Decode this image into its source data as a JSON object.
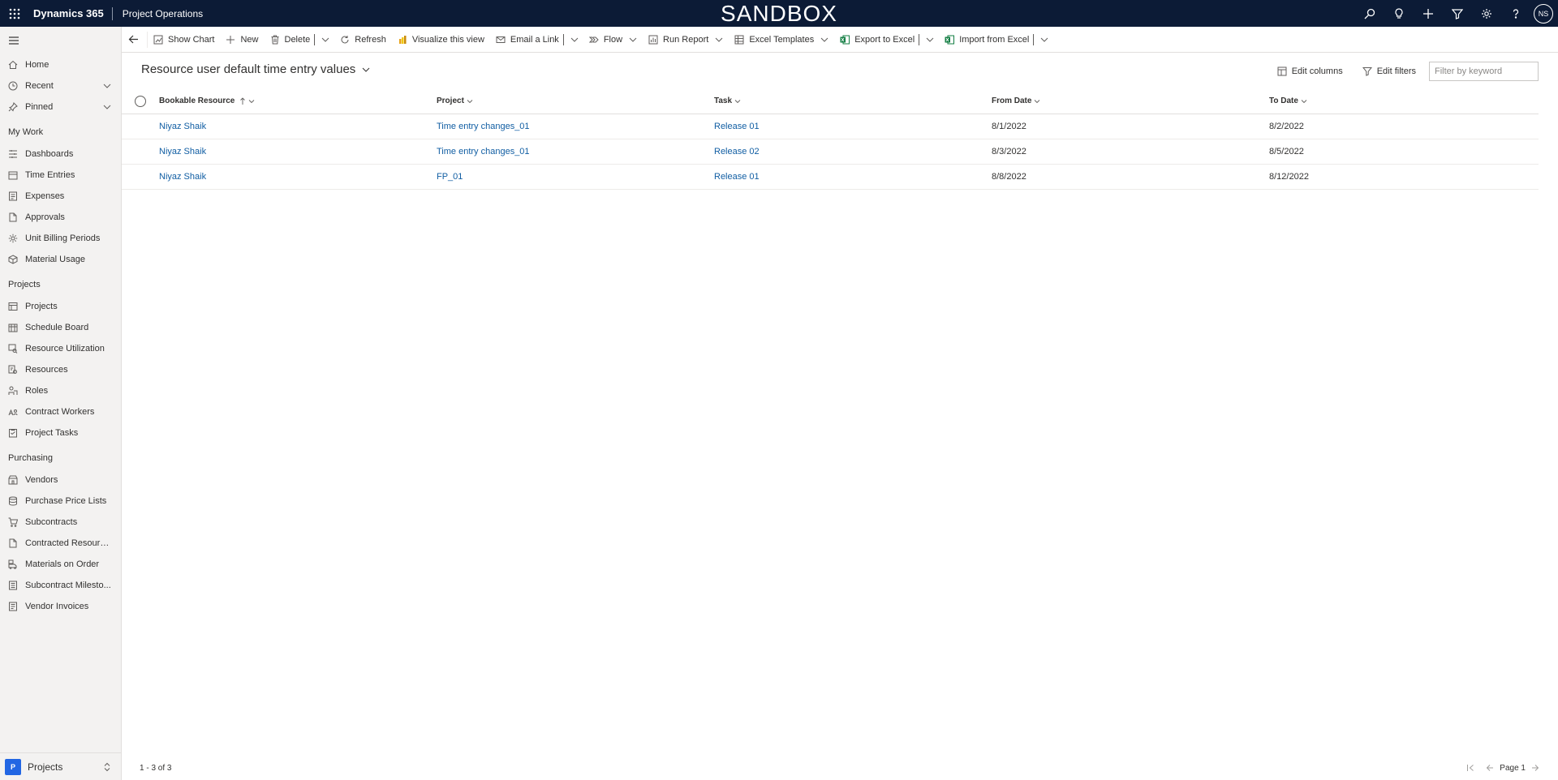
{
  "topbar": {
    "brand": "Dynamics 365",
    "app": "Project Operations",
    "environment": "SANDBOX",
    "avatar": "NS",
    "icons": [
      "search-icon",
      "lightbulb-icon",
      "plus-icon",
      "filter-icon",
      "gear-icon",
      "help-icon"
    ]
  },
  "sidebar": {
    "top": [
      {
        "label": "Home",
        "icon": "home-icon"
      },
      {
        "label": "Recent",
        "icon": "clock-icon"
      },
      {
        "label": "Pinned",
        "icon": "pin-icon"
      }
    ],
    "sections": [
      {
        "title": "My Work",
        "items": [
          {
            "label": "Dashboards",
            "icon": "dashboard-icon"
          },
          {
            "label": "Time Entries",
            "icon": "calendar-icon"
          },
          {
            "label": "Expenses",
            "icon": "expense-icon"
          },
          {
            "label": "Approvals",
            "icon": "document-icon"
          },
          {
            "label": "Unit Billing Periods",
            "icon": "gear-icon"
          },
          {
            "label": "Material Usage",
            "icon": "cube-icon"
          }
        ]
      },
      {
        "title": "Projects",
        "items": [
          {
            "label": "Projects",
            "icon": "board-icon"
          },
          {
            "label": "Schedule Board",
            "icon": "calendar-icon"
          },
          {
            "label": "Resource Utilization",
            "icon": "chart-search-icon"
          },
          {
            "label": "Resources",
            "icon": "resource-icon"
          },
          {
            "label": "Roles",
            "icon": "people-icon"
          },
          {
            "label": "Contract Workers",
            "icon": "contract-worker-icon"
          },
          {
            "label": "Project Tasks",
            "icon": "task-icon"
          }
        ]
      },
      {
        "title": "Purchasing",
        "items": [
          {
            "label": "Vendors",
            "icon": "vendor-icon"
          },
          {
            "label": "Purchase Price Lists",
            "icon": "price-list-icon"
          },
          {
            "label": "Subcontracts",
            "icon": "cart-icon"
          },
          {
            "label": "Contracted Resource...",
            "icon": "document-icon"
          },
          {
            "label": "Materials on Order",
            "icon": "truck-icon"
          },
          {
            "label": "Subcontract Milesto...",
            "icon": "milestone-icon"
          },
          {
            "label": "Vendor Invoices",
            "icon": "invoice-icon"
          }
        ]
      }
    ],
    "area": {
      "badge": "P",
      "label": "Projects"
    }
  },
  "commandbar": {
    "show_chart": "Show Chart",
    "new": "New",
    "delete": "Delete",
    "refresh": "Refresh",
    "visualize": "Visualize this view",
    "email_link": "Email a Link",
    "flow": "Flow",
    "run_report": "Run Report",
    "excel_templates": "Excel Templates",
    "export_excel": "Export to Excel",
    "import_excel": "Import from Excel"
  },
  "view": {
    "title": "Resource user default time entry values",
    "edit_columns": "Edit columns",
    "edit_filters": "Edit filters",
    "filter_placeholder": "Filter by keyword"
  },
  "grid": {
    "columns": [
      "Bookable Resource",
      "Project",
      "Task",
      "From Date",
      "To Date"
    ],
    "rows": [
      {
        "resource": "Niyaz Shaik",
        "project": "Time entry changes_01",
        "task": "Release 01",
        "from": "8/1/2022",
        "to": "8/2/2022"
      },
      {
        "resource": "Niyaz Shaik",
        "project": "Time entry changes_01",
        "task": "Release 02",
        "from": "8/3/2022",
        "to": "8/5/2022"
      },
      {
        "resource": "Niyaz Shaik",
        "project": "FP_01",
        "task": "Release 01",
        "from": "8/8/2022",
        "to": "8/12/2022"
      }
    ]
  },
  "footer": {
    "count": "1 - 3 of 3",
    "page": "Page 1"
  },
  "colors": {
    "topbar": "#0c1b36",
    "link": "#115ea3",
    "area_badge": "#2266e3",
    "excel_green": "#107c41",
    "powerbi_yellow": "#e8a317"
  }
}
